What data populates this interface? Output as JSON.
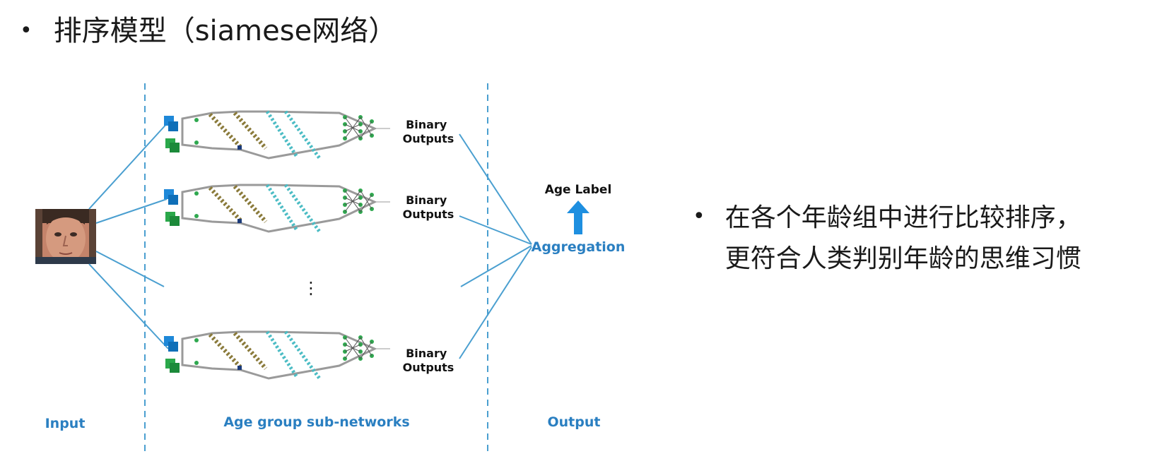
{
  "title": "排序模型（siamese网络）",
  "side_note": "在各个年龄组中进行比较排序，更符合人类判别年龄的思维习惯",
  "diagram": {
    "binary_outputs": [
      "Binary\nOutputs",
      "Binary\nOutputs",
      "Binary\nOutputs"
    ],
    "binary_line1": "Binary",
    "binary_line2": "Outputs",
    "ellipsis": "⋮",
    "age_label": "Age Label",
    "aggregation": "Aggregation",
    "input_label": "Input",
    "subnet_label": "Age group sub-networks",
    "output_label": "Output"
  },
  "colors": {
    "accent_blue": "#2a7fc1",
    "arrow_blue": "#1e8fe0",
    "net_gray": "#9a9a9a",
    "node_teal": "#4bbcc4",
    "node_olive": "#8a7a3a",
    "node_green": "#2fa84f",
    "input_cube_blue": "#1e88d8",
    "input_cube_green": "#2aa84a"
  },
  "icons": [
    "bullet-dot",
    "face-photo",
    "up-arrow-icon"
  ]
}
